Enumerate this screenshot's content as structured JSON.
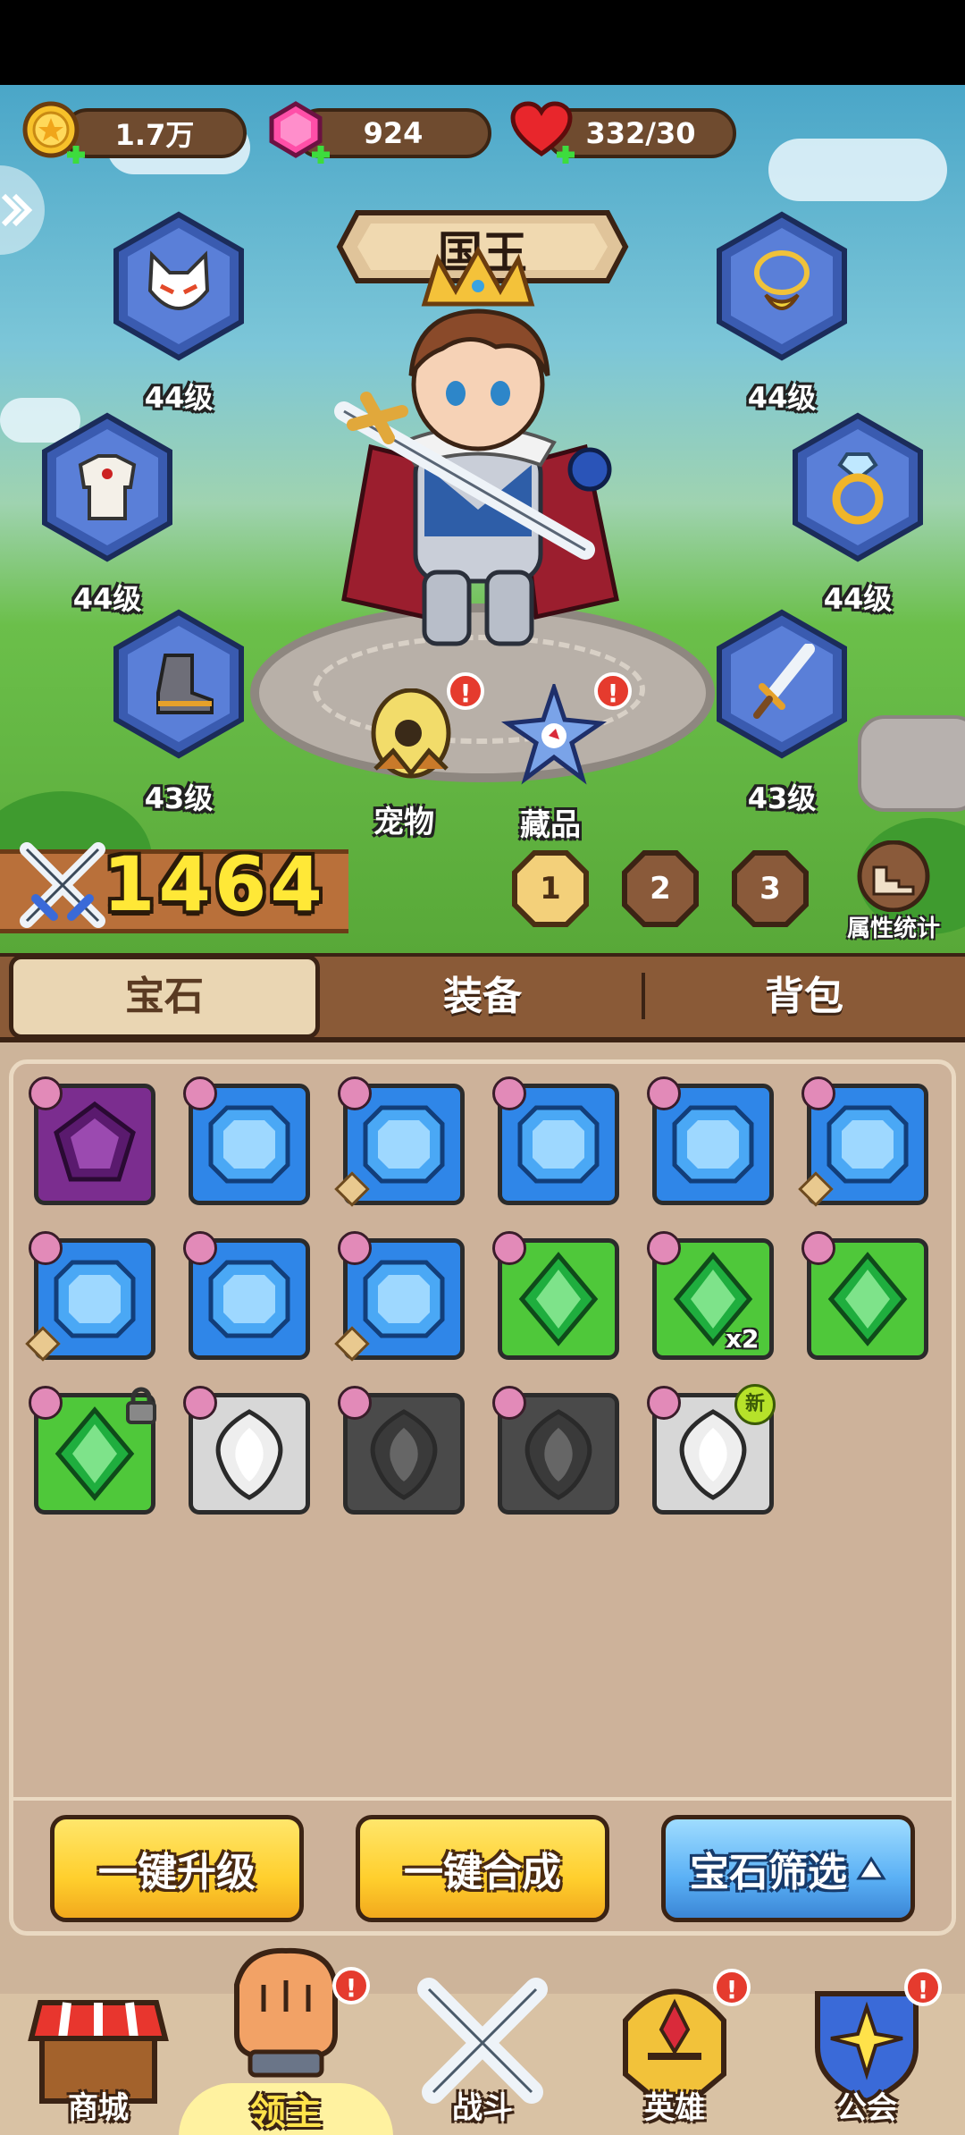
{
  "resources": {
    "gold": "1.7万",
    "gems": "924",
    "stamina": "332/30"
  },
  "hero": {
    "title": "国王"
  },
  "equipment": [
    {
      "slot": "mask",
      "level": "44级"
    },
    {
      "slot": "necklace",
      "level": "44级"
    },
    {
      "slot": "armor",
      "level": "44级"
    },
    {
      "slot": "ring",
      "level": "44级"
    },
    {
      "slot": "boots",
      "level": "43级"
    },
    {
      "slot": "sword",
      "level": "43级"
    }
  ],
  "companions": {
    "pet_label": "宠物",
    "collection_label": "藏品",
    "alert_glyph": "!"
  },
  "power": "1464",
  "loadout_pages": [
    "1",
    "2",
    "3"
  ],
  "stats_label": "属性统计",
  "tabs": [
    "宝石",
    "装备",
    "背包"
  ],
  "inventory": {
    "items": [
      {
        "kind": "purple",
        "diamond": false
      },
      {
        "kind": "blue",
        "diamond": false
      },
      {
        "kind": "blue",
        "diamond": true
      },
      {
        "kind": "blue",
        "diamond": false
      },
      {
        "kind": "blue",
        "diamond": false
      },
      {
        "kind": "blue",
        "diamond": true
      },
      {
        "kind": "blue",
        "diamond": true
      },
      {
        "kind": "blue",
        "diamond": false
      },
      {
        "kind": "blue",
        "diamond": true
      },
      {
        "kind": "green",
        "diamond": false
      },
      {
        "kind": "green",
        "diamond": false,
        "quantity": "x2"
      },
      {
        "kind": "green",
        "diamond": false
      },
      {
        "kind": "green",
        "diamond": false,
        "locked": true
      },
      {
        "kind": "silver",
        "diamond": false
      },
      {
        "kind": "dark",
        "diamond": false
      },
      {
        "kind": "dark",
        "diamond": false
      },
      {
        "kind": "silver",
        "diamond": false,
        "new": "新"
      }
    ]
  },
  "actions": {
    "upgrade_all": "一键升级",
    "merge_all": "一键合成",
    "filter": "宝石筛选"
  },
  "nav": {
    "shop": "商城",
    "lord": "领主",
    "battle": "战斗",
    "heroes": "英雄",
    "guild": "公会"
  }
}
